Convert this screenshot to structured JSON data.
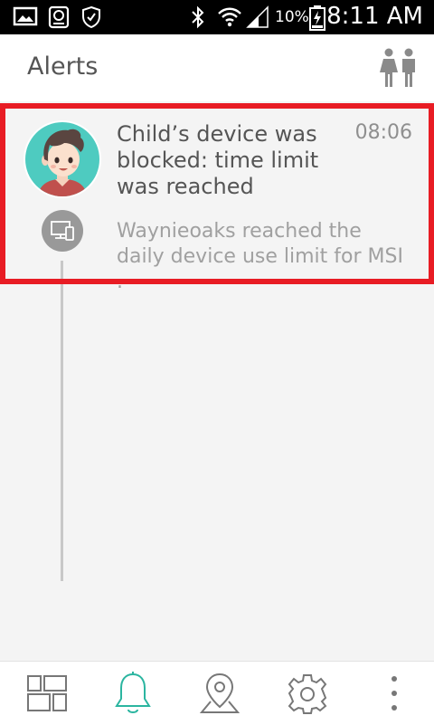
{
  "status_bar": {
    "battery_percent": "10%",
    "time": "8:11 AM",
    "icons": [
      "image-icon",
      "sync-icon",
      "shield-icon",
      "bluetooth-icon",
      "wifi-icon",
      "signal-icon",
      "battery-charging-icon"
    ]
  },
  "header": {
    "title": "Alerts",
    "family_icon": "family-icon"
  },
  "alert": {
    "title": "Child’s device was blocked: time limit was reached",
    "time": "08:06",
    "message": "Waynieoaks reached the daily device use limit for MSI .",
    "avatar_icon": "child-avatar",
    "badge_icon": "devices-icon"
  },
  "bottom_nav": {
    "items": [
      {
        "icon": "dashboard-icon"
      },
      {
        "icon": "bell-icon",
        "active": true
      },
      {
        "icon": "location-icon"
      },
      {
        "icon": "gear-icon"
      },
      {
        "icon": "more-vert-icon"
      }
    ]
  },
  "colors": {
    "highlight": "#e81c24",
    "accent": "#2bb5a0",
    "text_primary": "#555555",
    "text_secondary": "#a0a0a0",
    "background": "#f4f4f4"
  }
}
